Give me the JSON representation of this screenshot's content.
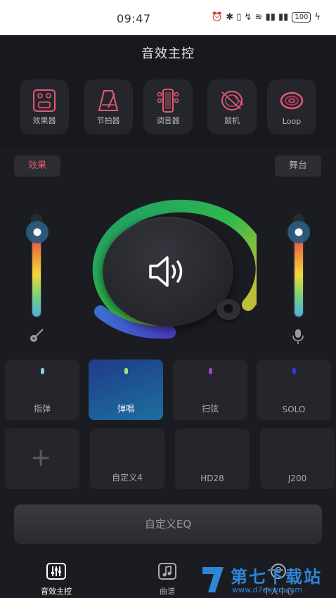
{
  "status_bar": {
    "time": "09:47",
    "icons_text": "⏰ ✱ ▯ ↯ ≋ ▮▮ ▮▮",
    "battery": "100"
  },
  "header": {
    "title": "音效主控"
  },
  "tools": [
    {
      "label": "效果器",
      "icon": "effects-pedal-icon"
    },
    {
      "label": "节拍器",
      "icon": "metronome-icon"
    },
    {
      "label": "调音器",
      "icon": "tuner-icon"
    },
    {
      "label": "鼓机",
      "icon": "drum-icon"
    },
    {
      "label": "Loop",
      "icon": "loop-icon"
    }
  ],
  "mode_pills": {
    "effects": "效果",
    "stage": "舞台"
  },
  "sliders": {
    "left_level": 0.83,
    "right_level": 0.83
  },
  "main_button": {
    "icon": "speaker-icon"
  },
  "presets_row1": [
    {
      "name": "指弹",
      "dot_color": "#8fc9f0"
    },
    {
      "name": "弹唱",
      "dot_color": "#a8e07a"
    },
    {
      "name": "扫弦",
      "dot_color": "#9a4ac0"
    },
    {
      "name": "SOLO",
      "dot_color": "#2a3ae8"
    }
  ],
  "presets_row2": [
    {
      "name": ""
    },
    {
      "name": "自定义4"
    },
    {
      "name": "HD28"
    },
    {
      "name": "J200"
    }
  ],
  "eq_button": {
    "label": "自定义EQ"
  },
  "bottom_nav": [
    {
      "label": "音效主控"
    },
    {
      "label": "曲谱"
    },
    {
      "label": "个人中心"
    }
  ],
  "watermark": {
    "brand": "第七下载站",
    "url": "www.d7down.com"
  },
  "colors": {
    "accent": "#e05a76",
    "active_preset": "#1f3c88",
    "background": "#1b1c21"
  }
}
